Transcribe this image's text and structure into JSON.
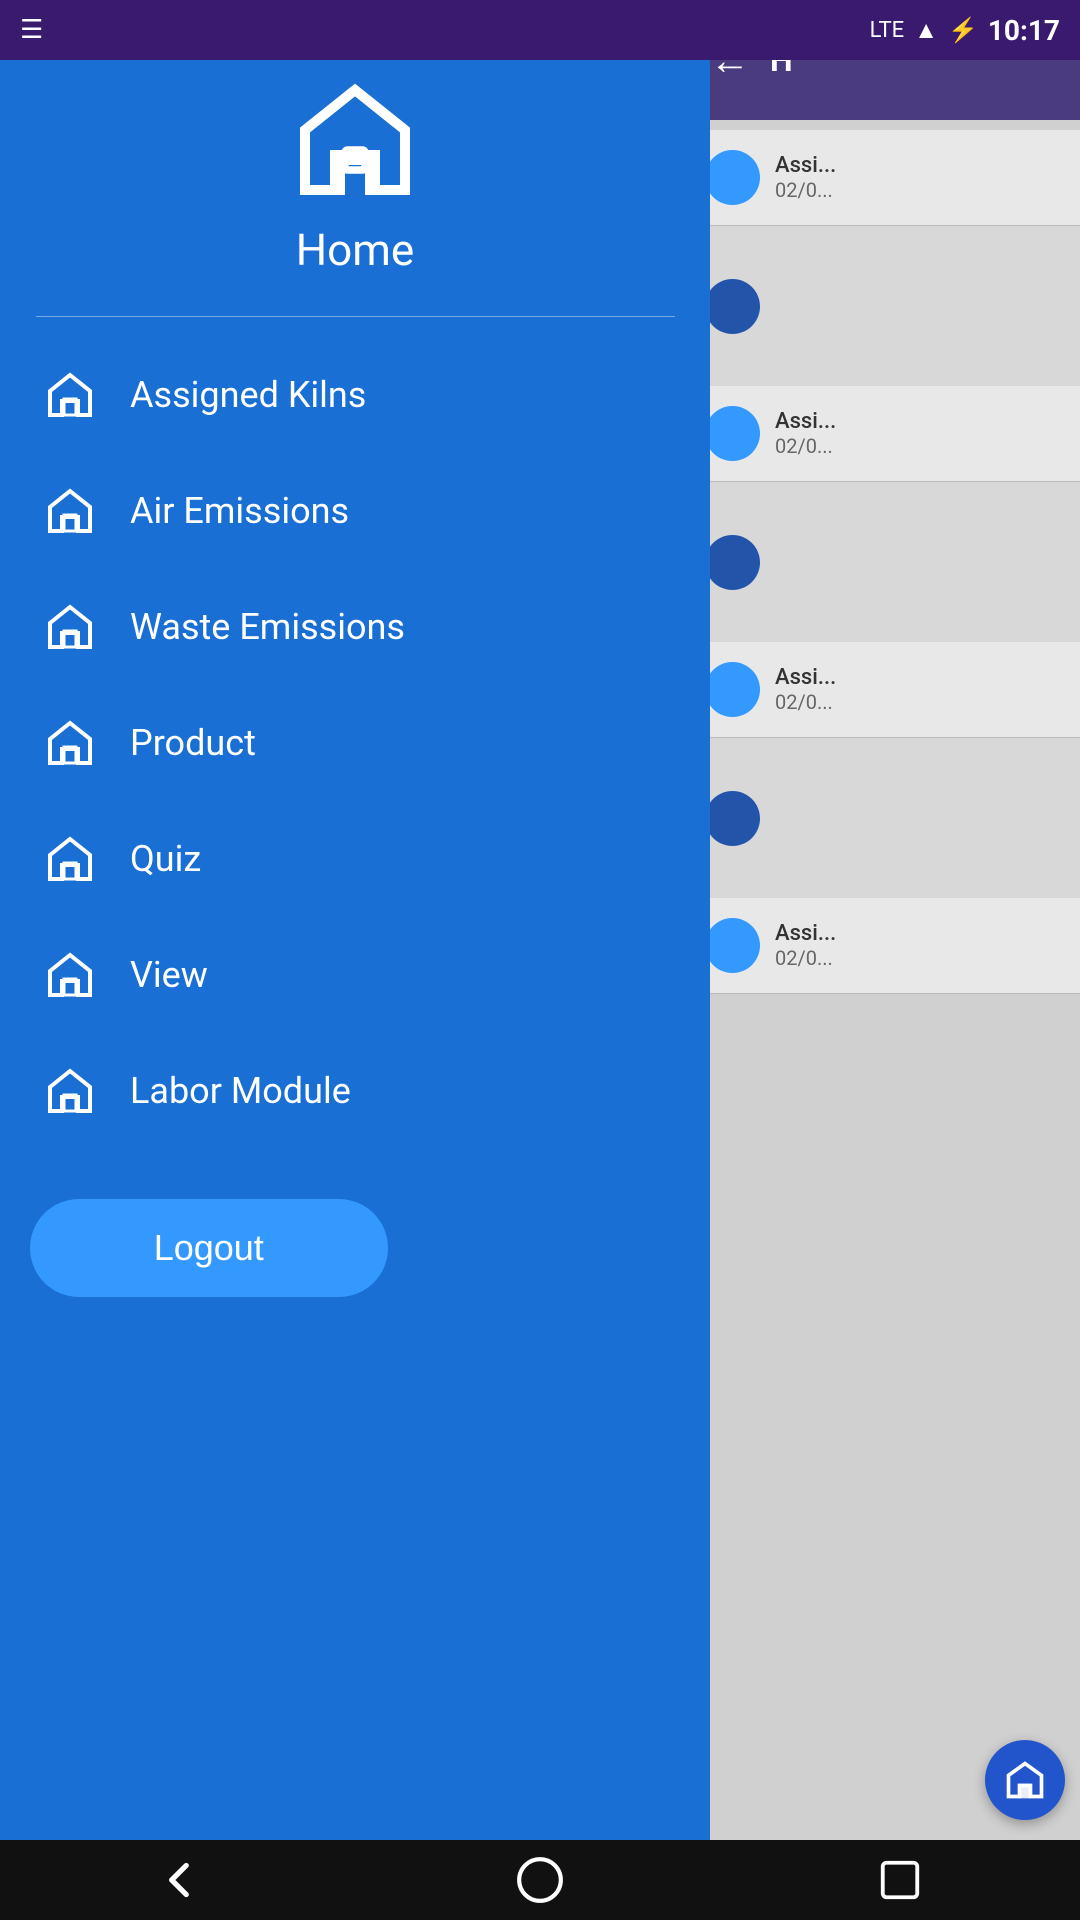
{
  "statusBar": {
    "time": "10:17",
    "icons": {
      "sim": "sim-icon",
      "lte": "LTE",
      "battery": "battery-icon",
      "notification": "notification-icon"
    }
  },
  "leftPanel": {
    "homeTitle": "Home",
    "divider": true,
    "navItems": [
      {
        "id": "assigned-kilns",
        "label": "Assigned Kilns"
      },
      {
        "id": "air-emissions",
        "label": "Air Emissions"
      },
      {
        "id": "waste-emissions",
        "label": "Waste Emissions"
      },
      {
        "id": "product",
        "label": "Product"
      },
      {
        "id": "quiz",
        "label": "Quiz"
      },
      {
        "id": "view",
        "label": "View"
      },
      {
        "id": "labor-module",
        "label": "Labor Module"
      }
    ],
    "logoutLabel": "Logout"
  },
  "rightPanel": {
    "backLabel": "←",
    "headerLetter": "H",
    "items": [
      {
        "label": "Assi...",
        "date": "02/0..."
      },
      {
        "label": "Assi...",
        "date": "02/0..."
      },
      {
        "label": "Assi...",
        "date": "02/0..."
      },
      {
        "label": "Assi...",
        "date": "02/0..."
      }
    ]
  },
  "bottomNav": {
    "backLabel": "◁",
    "homeLabel": "□"
  },
  "colors": {
    "leftPanelBg": "#1a6fd4",
    "rightPanelHeaderBg": "#4a3a7e",
    "statusBarBg": "#3a1a6e",
    "logoutBtnBg": "#3399ff",
    "homeFabBg": "#2255cc"
  }
}
